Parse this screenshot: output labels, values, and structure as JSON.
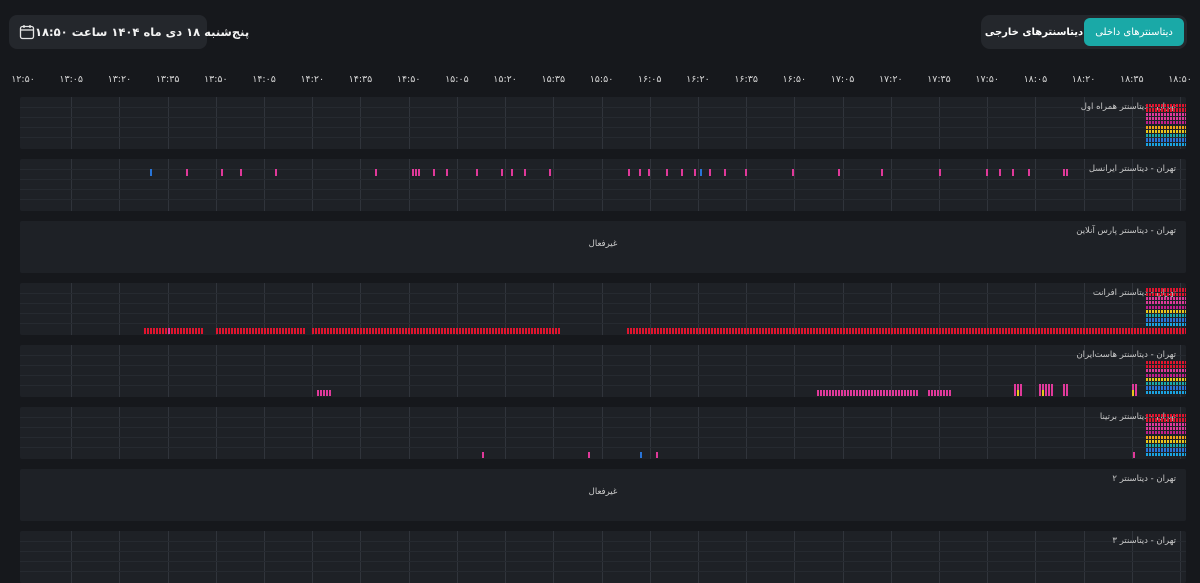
{
  "header": {
    "date_text": "پنج‌شنبه ۱۸ دی ماه ۱۴۰۴ ساعت ۱۸:۵۰",
    "calendar_icon": "calendar-icon"
  },
  "tabs": [
    {
      "label": "دیتاسنترهای داخلی",
      "active": true
    },
    {
      "label": "دیتاسنترهای خارجی",
      "active": false
    }
  ],
  "time_axis": [
    "۱۲:۵۰",
    "۱۳:۰۵",
    "۱۳:۲۰",
    "۱۳:۳۵",
    "۱۳:۵۰",
    "۱۴:۰۵",
    "۱۴:۲۰",
    "۱۴:۳۵",
    "۱۴:۵۰",
    "۱۵:۰۵",
    "۱۵:۲۰",
    "۱۵:۳۵",
    "۱۵:۵۰",
    "۱۶:۰۵",
    "۱۶:۲۰",
    "۱۶:۳۵",
    "۱۶:۵۰",
    "۱۷:۰۵",
    "۱۷:۲۰",
    "۱۷:۳۵",
    "۱۷:۵۰",
    "۱۸:۰۵",
    "۱۸:۲۰",
    "۱۸:۳۵",
    "۱۸:۵۰"
  ],
  "colors": {
    "red": "#e0142e",
    "pink": "#e0399a",
    "magenta": "#c21d8d",
    "yellow": "#e8c61b",
    "orange": "#f0a018",
    "blue": "#2874d8",
    "cyan": "#1aa3e0",
    "teal": "#1aa9a7"
  },
  "datacenters": [
    {
      "title": "تهران - دیتاسنتر همراه اول",
      "status": "active"
    },
    {
      "title": "تهران - دیتاسنتر ایرانسل",
      "status": "active"
    },
    {
      "title": "تهران - دیتاسنتر پارس آنلاین",
      "status": "inactive",
      "status_label": "غیرفعال"
    },
    {
      "title": "تهران - دیتاسنتر افرانت",
      "status": "active"
    },
    {
      "title": "تهران - دیتاسنتر هاست‌ایران",
      "status": "active"
    },
    {
      "title": "تهران - دیتاسنتر برتینا",
      "status": "active"
    },
    {
      "title": "تهران - دیتاسنتر ۲",
      "status": "inactive",
      "status_label": "غیرفعال"
    },
    {
      "title": "تهران - دیتاسنتر ۳",
      "status": "active"
    }
  ]
}
